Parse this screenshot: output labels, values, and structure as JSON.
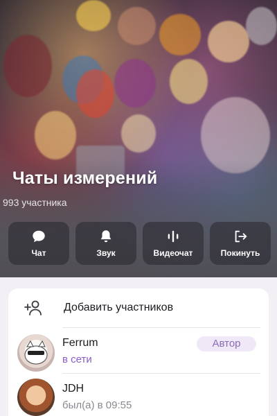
{
  "chat": {
    "title": "Чаты измерений",
    "members": "993 участника"
  },
  "actions": [
    {
      "label": "Чат",
      "icon": "chat-bubble-icon"
    },
    {
      "label": "Звук",
      "icon": "bell-icon"
    },
    {
      "label": "Видеочат",
      "icon": "voice-bars-icon"
    },
    {
      "label": "Покинуть",
      "icon": "leave-icon"
    }
  ],
  "add_members": {
    "label": "Добавить участников",
    "icon": "add-person-icon"
  },
  "members_list": [
    {
      "name": "Ferrum",
      "status": "в сети",
      "role": "Автор",
      "status_color": "#8b5fc7"
    },
    {
      "name": "JDH",
      "status": "был(а) в 09:55",
      "status_color": "#8a878f"
    }
  ],
  "colors": {
    "accent": "#8b5fc7",
    "badge_bg": "#efe9f7",
    "card_bg": "#ffffff"
  }
}
